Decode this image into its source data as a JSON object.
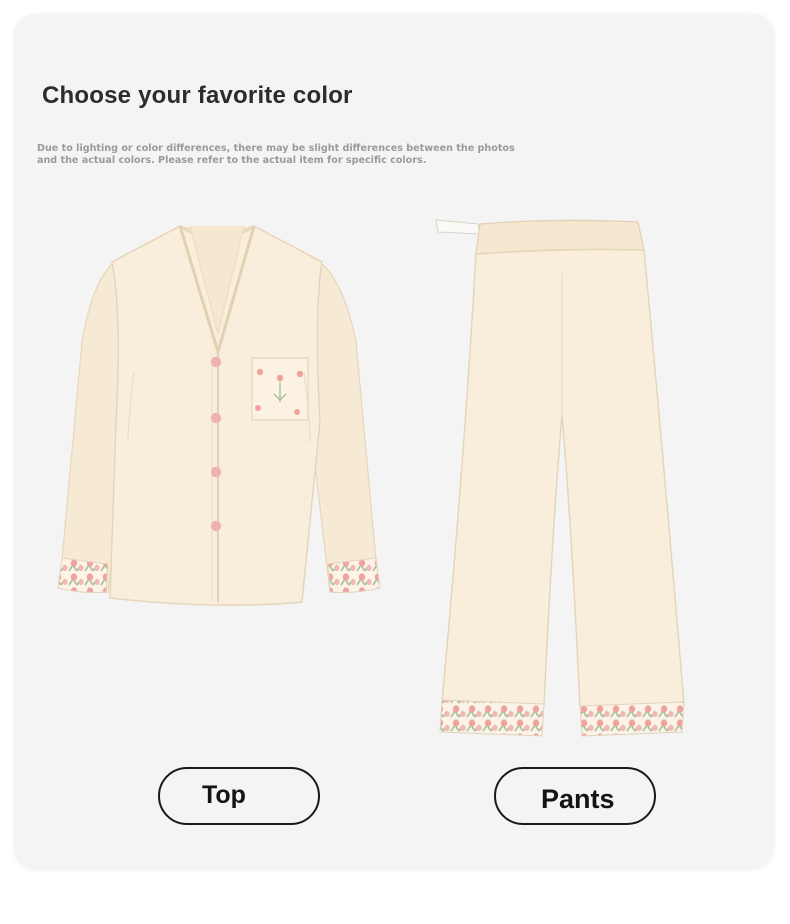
{
  "heading": "Choose your favorite color",
  "disclaimer": {
    "line1": "Due to lighting or color differences, there may be slight differences between the photos",
    "line2": " and the actual colors. Please refer to the actual item for specific colors."
  },
  "options": {
    "top_label": "Top",
    "pants_label": "Pants"
  },
  "colors": {
    "fabric": "#f8ecd8",
    "fabric_shadow": "#eadcc2",
    "tulip_pink": "#eea39c",
    "leaf_green": "#a7c09a",
    "button_pink": "#efb3ad"
  }
}
